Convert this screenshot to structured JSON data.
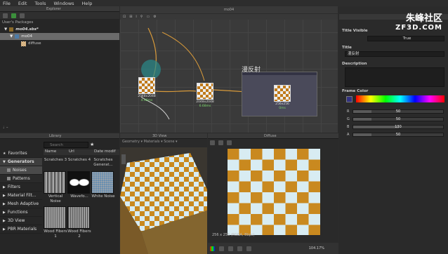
{
  "menu": [
    "File",
    "Edit",
    "Tools",
    "Windows",
    "Help"
  ],
  "explorer": {
    "title": "Explorer",
    "header": "User's Packages",
    "package": "mo04.sbs*",
    "graph": "mo04",
    "item": "diffuse"
  },
  "graph": {
    "tab": "mo04",
    "frame_label": "漫反射",
    "node1": {
      "size": "2048x2048",
      "time": "4.98ms"
    },
    "node2": {
      "size": "2048x2048",
      "time": "6.68ms"
    },
    "node3": {
      "size": "256x256",
      "time": "0ms"
    }
  },
  "properties": {
    "title_visible_label": "Title Visible",
    "title_visible_value": "True",
    "title_label": "Title",
    "title_value": "漫反射",
    "description_label": "Description",
    "frame_color_label": "Frame Color",
    "channels": [
      {
        "name": "R",
        "value": "50",
        "fraction": 0.2
      },
      {
        "name": "G",
        "value": "50",
        "fraction": 0.2
      },
      {
        "name": "B",
        "value": "130",
        "fraction": 0.51
      },
      {
        "name": "A",
        "value": "50",
        "fraction": 0.2
      }
    ]
  },
  "watermark": {
    "brand": "朱峰社区",
    "url": "ZF3D.COM"
  },
  "library": {
    "title": "Library",
    "search_placeholder": "Search",
    "columns": [
      "Name",
      "Url",
      "Date modif"
    ],
    "categories": [
      {
        "label": "Favorites",
        "icon": "★",
        "active": false
      },
      {
        "label": "Generators",
        "icon": "▼",
        "active": true
      },
      {
        "label": "Noises",
        "icon": "",
        "active": false,
        "sub": true
      },
      {
        "label": "Patterns",
        "icon": "",
        "active": false,
        "sub": true
      },
      {
        "label": "Filters",
        "icon": "▶",
        "active": false
      },
      {
        "label": "Material Filt...",
        "icon": "▶",
        "active": false
      },
      {
        "label": "Mesh Adaptive",
        "icon": "▶",
        "active": false
      },
      {
        "label": "Functions",
        "icon": "▶",
        "active": false
      },
      {
        "label": "3D View",
        "icon": "▶",
        "active": false
      },
      {
        "label": "PBR Materials",
        "icon": "▶",
        "active": false
      }
    ],
    "items": [
      {
        "label": "Scratches 3"
      },
      {
        "label": "Scratches 4"
      },
      {
        "label": "Scratches Generat..."
      },
      {
        "label": "Vertical Noise"
      },
      {
        "label": "Wavefo..."
      },
      {
        "label": "White Noise"
      },
      {
        "label": "Wood Fibers 1"
      },
      {
        "label": "Wood Fibers 2"
      }
    ]
  },
  "view3d": {
    "title": "3D View",
    "menu": "Geometry ▾ Materials ▾ Scene ▾"
  },
  "view2d": {
    "title": "Diffuse",
    "status": "256 x 256 (RGBA, 8bpc)",
    "zoom": "104.17%"
  }
}
